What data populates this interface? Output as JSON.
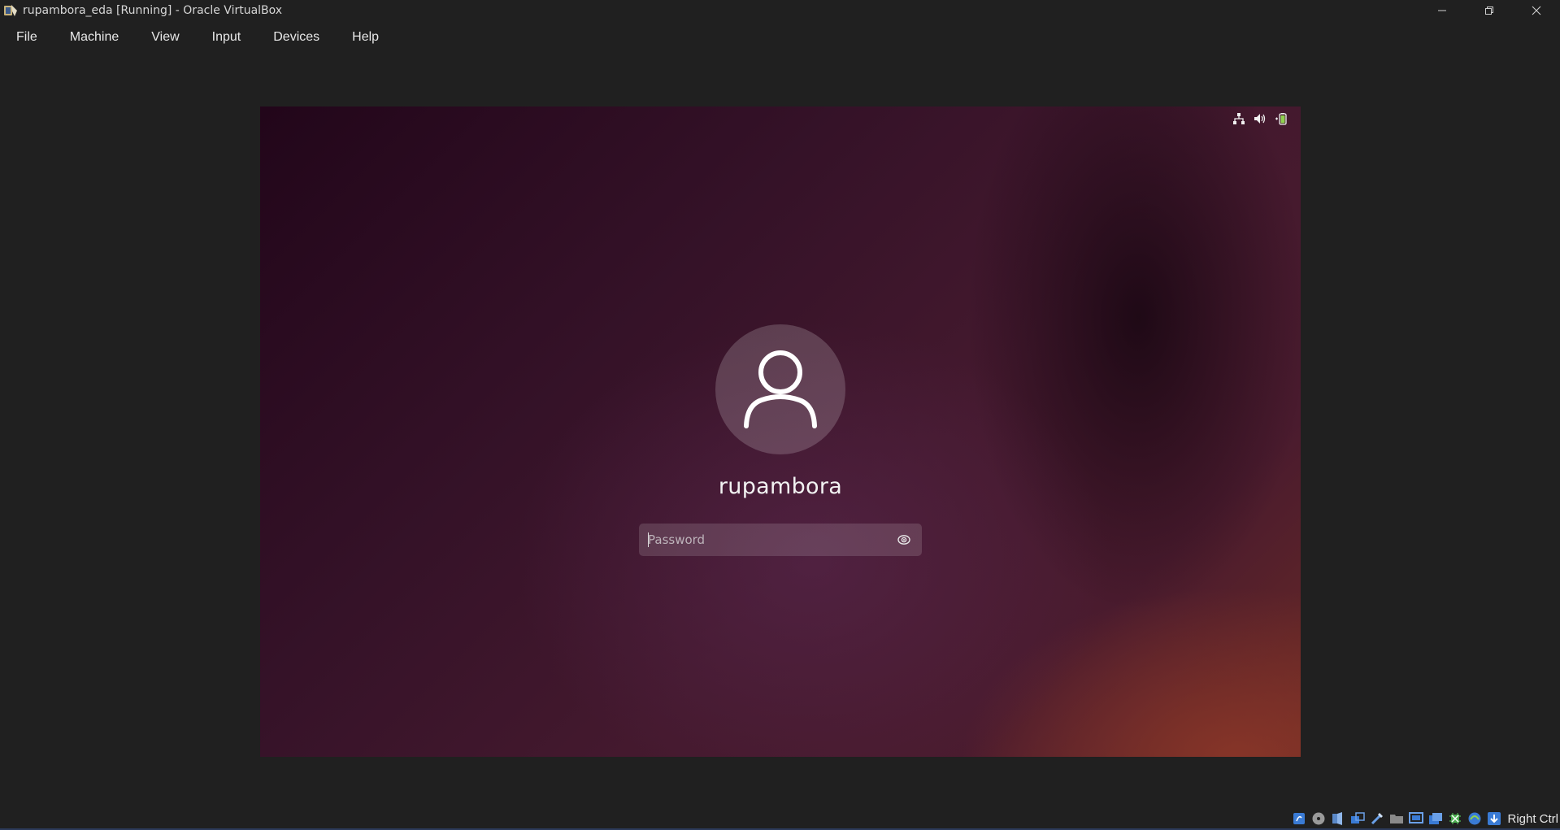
{
  "window": {
    "title": "rupambora_eda [Running] - Oracle VirtualBox"
  },
  "menu": {
    "items": [
      {
        "label": "File"
      },
      {
        "label": "Machine"
      },
      {
        "label": "View"
      },
      {
        "label": "Input"
      },
      {
        "label": "Devices"
      },
      {
        "label": "Help"
      }
    ]
  },
  "login": {
    "username": "rupambora",
    "password_placeholder": "Password",
    "password_value": ""
  },
  "guest_status_icons": [
    "network-icon",
    "volume-icon",
    "battery-icon"
  ],
  "statusbar": {
    "icons": [
      "hard-disk-icon",
      "optical-drive-icon",
      "audio-icon",
      "network-adapter-icon",
      "usb-icon",
      "shared-folders-icon",
      "display-icon",
      "recording-icon",
      "cpu-icon",
      "mouse-integration-icon",
      "keyboard-icon"
    ],
    "host_key": "Right Ctrl"
  }
}
